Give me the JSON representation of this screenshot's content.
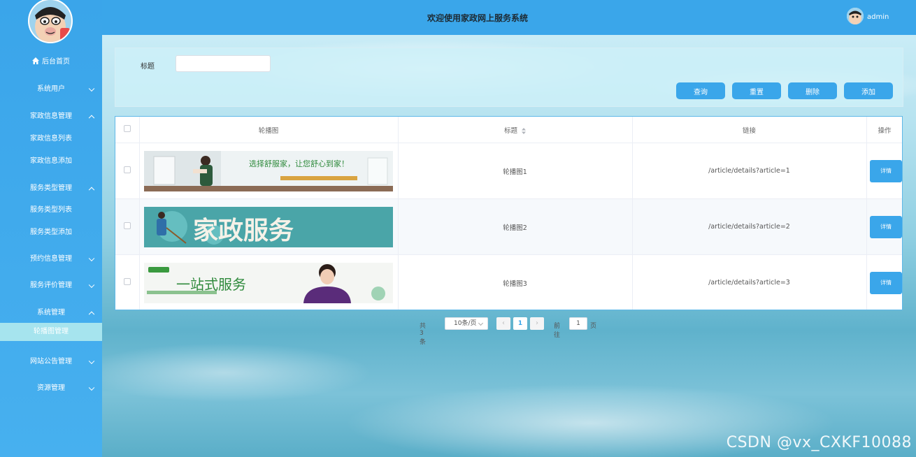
{
  "header": {
    "title": "欢迎使用家政网上服务系统",
    "user": "admin"
  },
  "sidebar": {
    "items": [
      {
        "label": "后台首页",
        "type": "home"
      },
      {
        "label": "系统用户",
        "type": "group",
        "expanded": false
      },
      {
        "label": "家政信息管理",
        "type": "group",
        "expanded": true
      },
      {
        "label": "家政信息列表",
        "type": "sub"
      },
      {
        "label": "家政信息添加",
        "type": "sub"
      },
      {
        "label": "服务类型管理",
        "type": "group",
        "expanded": true
      },
      {
        "label": "服务类型列表",
        "type": "sub"
      },
      {
        "label": "服务类型添加",
        "type": "sub"
      },
      {
        "label": "预约信息管理",
        "type": "group",
        "expanded": false
      },
      {
        "label": "服务评价管理",
        "type": "group",
        "expanded": false
      },
      {
        "label": "系统管理",
        "type": "group",
        "expanded": true
      },
      {
        "label": "轮播图管理",
        "type": "sub",
        "active": true
      },
      {
        "label": "网站公告管理",
        "type": "group",
        "expanded": false
      },
      {
        "label": "资源管理",
        "type": "group",
        "expanded": false
      }
    ]
  },
  "search": {
    "label": "标题",
    "value": "",
    "placeholder": ""
  },
  "buttons": {
    "query": "查询",
    "reset": "重置",
    "delete": "删除",
    "add": "添加"
  },
  "table": {
    "headers": {
      "image": "轮播图",
      "title": "标题",
      "link": "链接",
      "action": "操作"
    },
    "rows": [
      {
        "title": "轮播图1",
        "link": "/article/details?article=1",
        "action": "详情",
        "banner_text": "选择舒服家，让您舒心到家！"
      },
      {
        "title": "轮播图2",
        "link": "/article/details?article=2",
        "action": "详情",
        "banner_text": "家政服务"
      },
      {
        "title": "轮播图3",
        "link": "/article/details?article=3",
        "action": "详情",
        "banner_text": "一站式服务"
      }
    ]
  },
  "pagination": {
    "total": "共 3 条",
    "page_size": "10条/页",
    "current": "1",
    "goto_label": "前往",
    "goto_value": "1",
    "page_unit": "页"
  },
  "watermark": "CSDN @vx_CXKF10088",
  "colors": {
    "primary": "#3aa6ea",
    "sidebar": "#3aa5ea",
    "active_item": "#a6e4ee"
  }
}
